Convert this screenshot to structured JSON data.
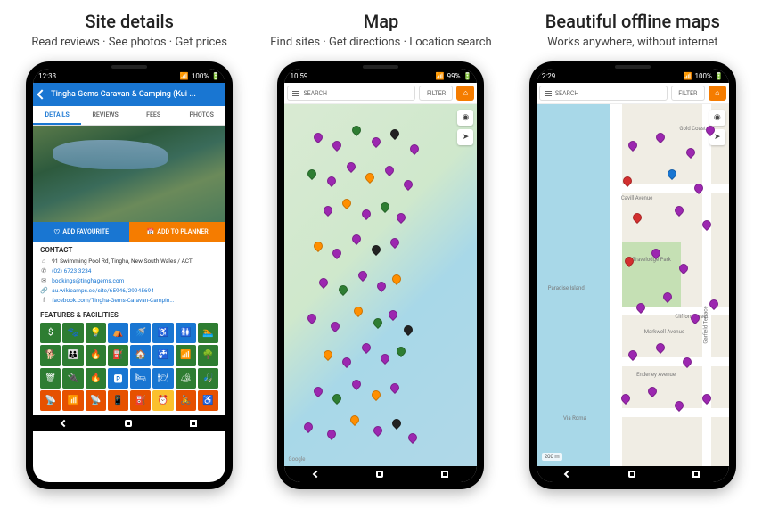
{
  "columns": [
    {
      "title": "Site details",
      "subtitle": "Read reviews · See photos · Get prices"
    },
    {
      "title": "Map",
      "subtitle": "Find sites · Get directions · Location search"
    },
    {
      "title": "Beautiful offline maps",
      "subtitle": "Works anywhere, without internet"
    }
  ],
  "status": {
    "time1": "12:33",
    "time2": "10:59",
    "time3": "2:29",
    "battery": "100%",
    "battery2": "99%"
  },
  "detail": {
    "title": "Tingha Gems Caravan & Camping (Kui ...",
    "tabs": [
      "DETAILS",
      "REVIEWS",
      "FEES",
      "PHOTOS"
    ],
    "fav_btn": "ADD FAVOURITE",
    "plan_btn": "ADD TO PLANNER",
    "contact_heading": "CONTACT",
    "address": "91 Swimming Pool Rd, Tingha, New South Wales / ACT",
    "phone": "(02) 6723 3234",
    "email": "bookings@tinghagems.com",
    "url": "au.wikicamps.co/site/65946/29945694",
    "fb": "facebook.com/Tingha-Gems-Caravan-Campin...",
    "facilities_heading": "FEATURES & FACILITIES"
  },
  "search": {
    "placeholder": "SEARCH",
    "filter": "FILTER"
  },
  "map3": {
    "labels": [
      "Gold Coast",
      "Cavill Avenue",
      "Paradise Island",
      "Travelodge Park",
      "Markwell Avenue",
      "Enderley Avenue",
      "Via Roma",
      "Garfield Terrace",
      "Clifford Street"
    ],
    "scale": "200 m"
  },
  "map2": {
    "google": "Google"
  },
  "facility_colors": [
    "#2e7d32",
    "#2e7d32",
    "#2e7d32",
    "#1976d2",
    "#1976d2",
    "#1976d2",
    "#1976d2",
    "#2e7d32",
    "#2e7d32",
    "#2e7d32",
    "#2e7d32",
    "#2e7d32",
    "#1976d2",
    "#1976d2",
    "#2e7d32",
    "#2e7d32",
    "#2e7d32",
    "#2e7d32",
    "#2e7d32",
    "#1976d2",
    "#1976d2",
    "#1976d2",
    "#2e7d32",
    "#2e7d32",
    "#e65100",
    "#e65100",
    "#e65100",
    "#e65100",
    "#e65100",
    "#fbc02d",
    "#e65100",
    "#e65100"
  ]
}
